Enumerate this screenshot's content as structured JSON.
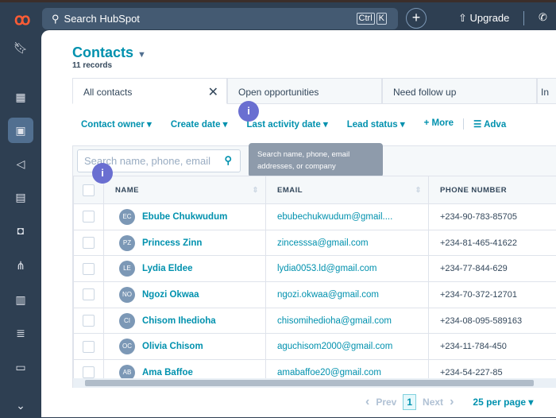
{
  "topbar": {
    "search_placeholder": "Search HubSpot",
    "kbd": [
      "Ctrl",
      "K"
    ],
    "upgrade": "Upgrade"
  },
  "page": {
    "title": "Contacts",
    "records": "11 records"
  },
  "tabs": [
    {
      "label": "All contacts"
    },
    {
      "label": "Open opportunities"
    },
    {
      "label": "Need follow up"
    },
    {
      "label": "In"
    }
  ],
  "filters": [
    "Contact owner ▾",
    "Create date ▾",
    "Last activity date ▾",
    "Lead status ▾",
    "+ More",
    "☰ Adva"
  ],
  "search": {
    "placeholder": "Search name, phone, email addresses, or company",
    "tooltip": "Search name, phone, email addresses, or company"
  },
  "badge": "i",
  "columns": [
    "NAME",
    "EMAIL",
    "PHONE NUMBER"
  ],
  "rows": [
    {
      "initials": "EC",
      "name": "Ebube Chukwudum",
      "email": "ebubechukwudum@gmail....",
      "phone": "+234-90-783-85705"
    },
    {
      "initials": "PZ",
      "name": "Princess Zinn",
      "email": "zincesssa@gmail.com",
      "phone": "+234-81-465-41622"
    },
    {
      "initials": "LE",
      "name": "Lydia Eldee",
      "email": "lydia0053.ld@gmail.com",
      "phone": "+234-77-844-629"
    },
    {
      "initials": "NO",
      "name": "Ngozi Okwaa",
      "email": "ngozi.okwaa@gmail.com",
      "phone": "+234-70-372-12701"
    },
    {
      "initials": "CI",
      "name": "Chisom Ihedioha",
      "email": "chisomihedioha@gmail.com",
      "phone": "+234-08-095-589163"
    },
    {
      "initials": "OC",
      "name": "Olivia Chisom",
      "email": "aguchisom2000@gmail.com",
      "phone": "+234-11-784-450"
    },
    {
      "initials": "AB",
      "name": "Ama Baffoe",
      "email": "amabaffoe20@gmail.com",
      "phone": "+234-54-227-85"
    }
  ],
  "pagination": {
    "prev": "Prev",
    "page": "1",
    "next": "Next",
    "per_page": "25 per page ▾"
  }
}
